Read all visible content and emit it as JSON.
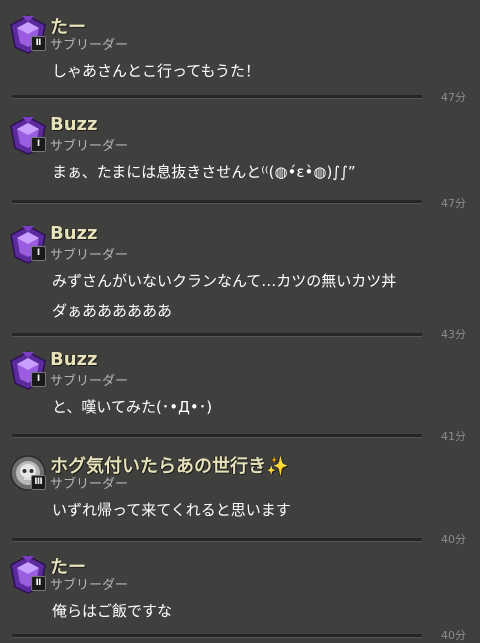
{
  "messages": [
    {
      "name": "たー",
      "role": "サブリーダー",
      "text": "しゃあさんとこ行ってもうた！",
      "time": "47分",
      "badge": "purple-gem-icon",
      "level": "Ⅱ"
    },
    {
      "name": "Buzz",
      "role": "サブリーダー",
      "text": "まぁ、たまには息抜きさせんと⁽⁽(◍•́ε•̀◍)∫∫”",
      "time": "47分",
      "badge": "purple-gem-icon",
      "level": "Ⅰ"
    },
    {
      "name": "Buzz",
      "role": "サブリーダー",
      "text": "みずさんがいないクランなんて…カツの無いカツ丼\nダぁああああああ",
      "time": "43分",
      "badge": "purple-gem-icon",
      "level": "Ⅰ"
    },
    {
      "name": "Buzz",
      "role": "サブリーダー",
      "text": "と、嘆いてみた(･•Д•･)",
      "time": "41分",
      "badge": "purple-gem-icon",
      "level": "Ⅰ"
    },
    {
      "name": "ホグ気付いたらあの世行き",
      "role": "サブリーダー",
      "text": "いずれ帰って来てくれると思います",
      "time": "40分",
      "badge": "silver-skull-icon",
      "level": "Ⅲ"
    },
    {
      "name": "たー",
      "role": "サブリーダー",
      "text": "俺らはご飯ですな",
      "time": "40分",
      "badge": "purple-gem-icon",
      "level": "Ⅱ"
    }
  ],
  "colors": {
    "background": "#3f3f3d",
    "name": "#e6e1b8",
    "role": "#b4b4b4",
    "text": "#ffffff",
    "time": "#8c8c8a"
  }
}
